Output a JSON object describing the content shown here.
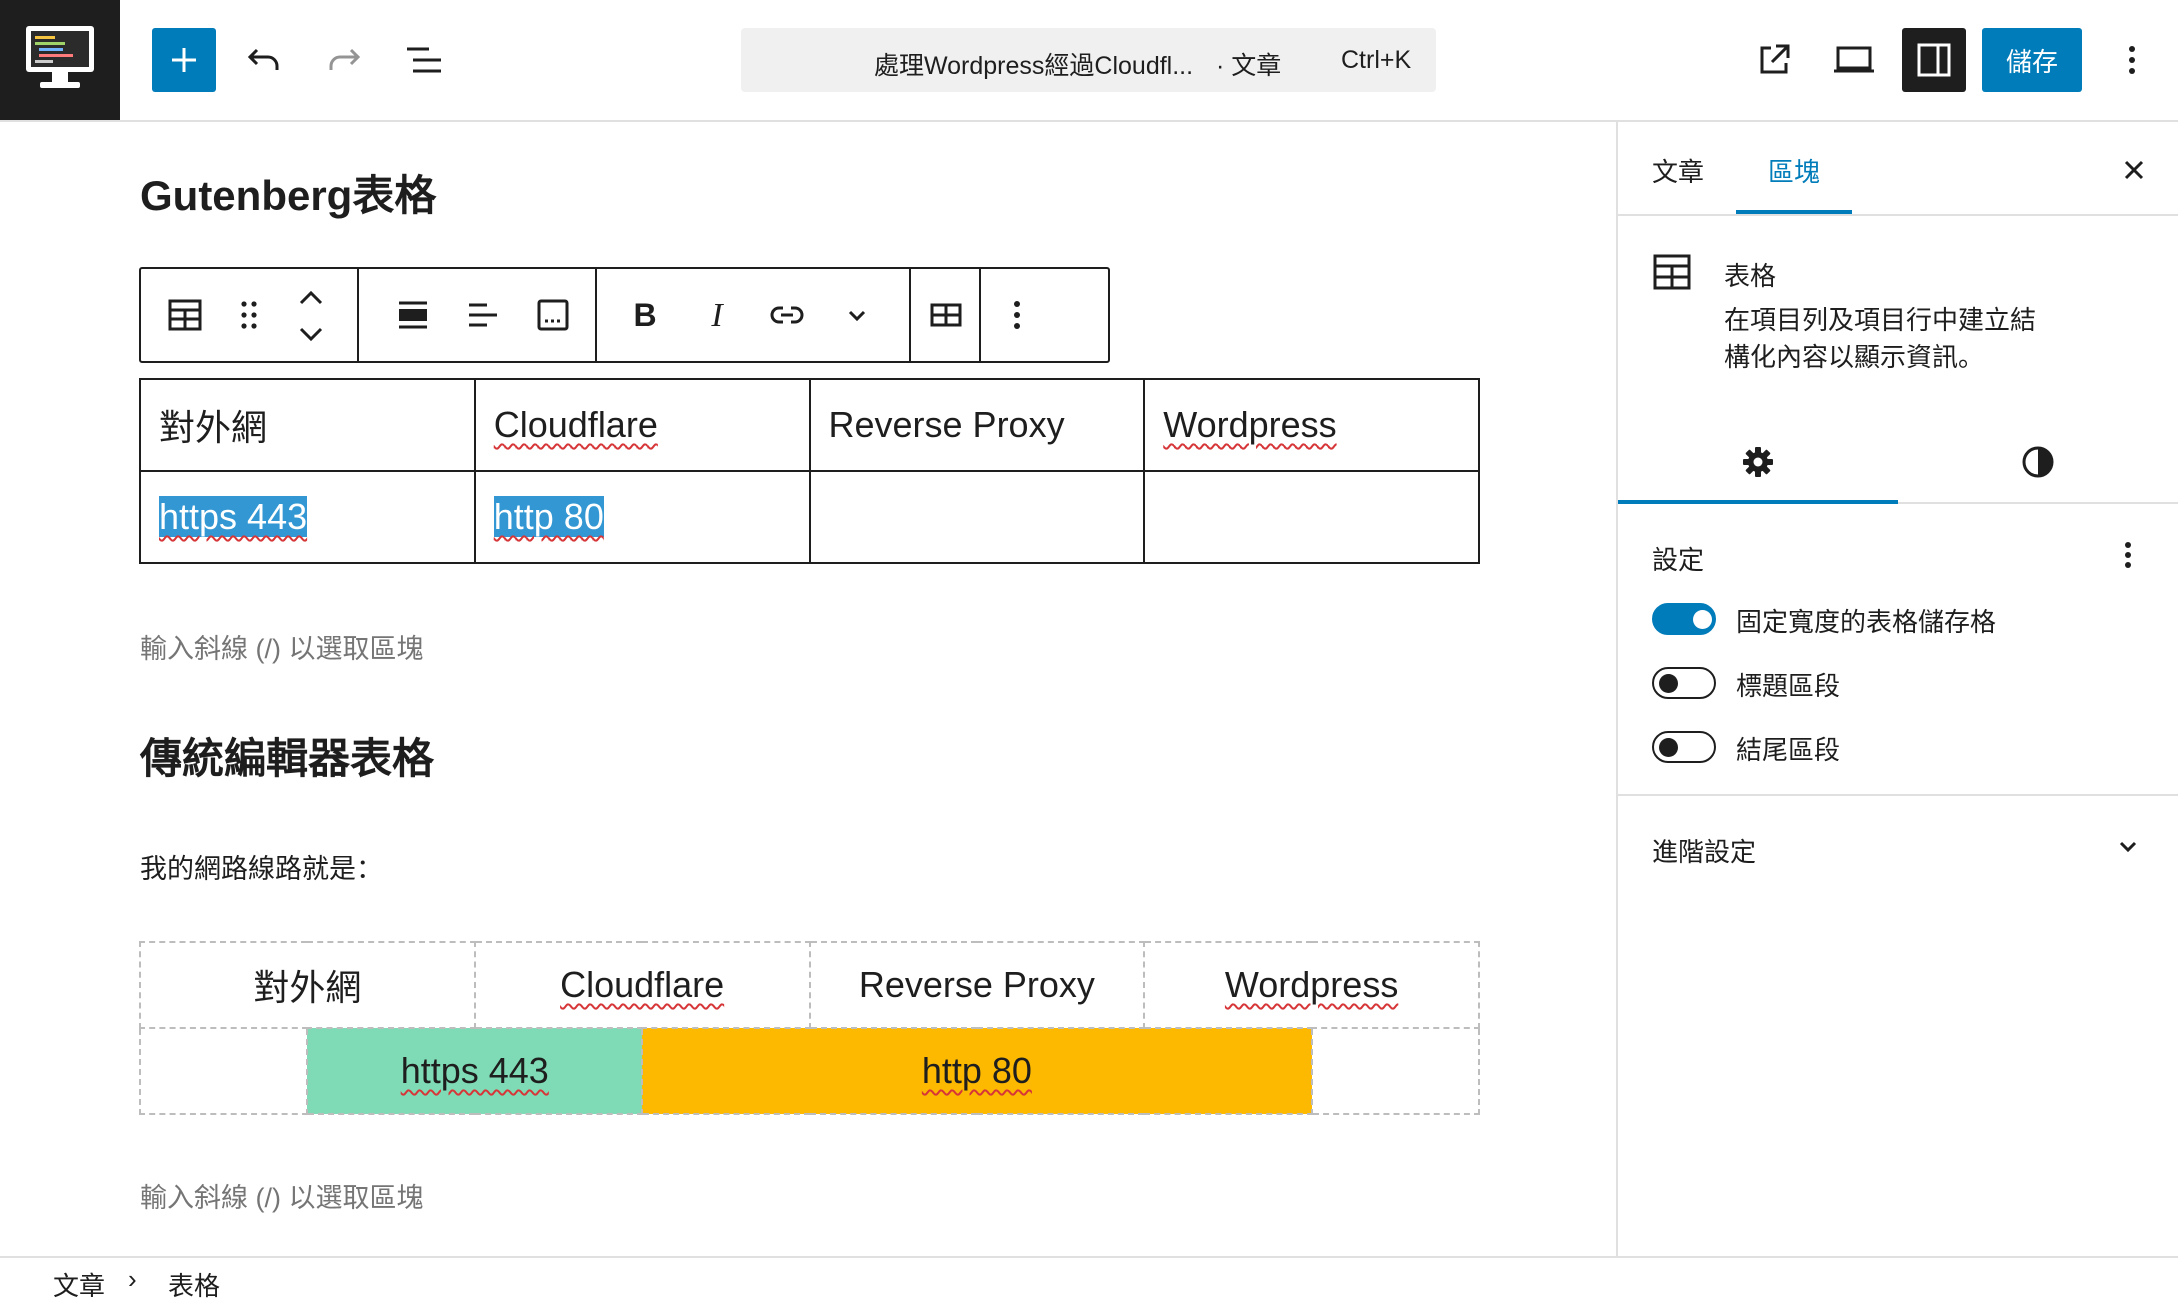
{
  "topbar": {
    "command_title": "處理Wordpress經過Cloudfl...",
    "command_type": "· 文章",
    "command_shortcut": "Ctrl+K",
    "save_label": "儲存"
  },
  "editor": {
    "heading1": "Gutenberg表格",
    "gutenberg_table": {
      "rows": [
        [
          "對外網",
          "Cloudflare",
          "Reverse Proxy",
          "Wordpress"
        ],
        [
          "https 443",
          "http 80",
          "",
          ""
        ]
      ]
    },
    "placeholder1": "輸入斜線 (/) 以選取區塊",
    "heading2": "傳統編輯器表格",
    "paragraph": "我的網路線路就是：",
    "classic_table": {
      "header": [
        "對外網",
        "Cloudflare",
        "Reverse Proxy",
        "Wordpress"
      ],
      "row2": [
        "https 443",
        "http 80"
      ],
      "colors": {
        "https": "#7fdbb6",
        "http": "#fcb900"
      }
    },
    "placeholder2": "輸入斜線 (/) 以選取區塊"
  },
  "sidebar": {
    "tab_post": "文章",
    "tab_block": "區塊",
    "block_title": "表格",
    "block_description": "在項目列及項目行中建立結構化內容以顯示資訊。",
    "settings_title": "設定",
    "toggles": [
      {
        "label": "固定寬度的表格儲存格",
        "on": true
      },
      {
        "label": "標題區段",
        "on": false
      },
      {
        "label": "結尾區段",
        "on": false
      }
    ],
    "advanced_title": "進階設定"
  },
  "breadcrumb": {
    "items": [
      "文章",
      "表格"
    ]
  },
  "colors": {
    "accent": "#007cba",
    "dark": "#1e1e1e",
    "selection": "#3297d3"
  }
}
